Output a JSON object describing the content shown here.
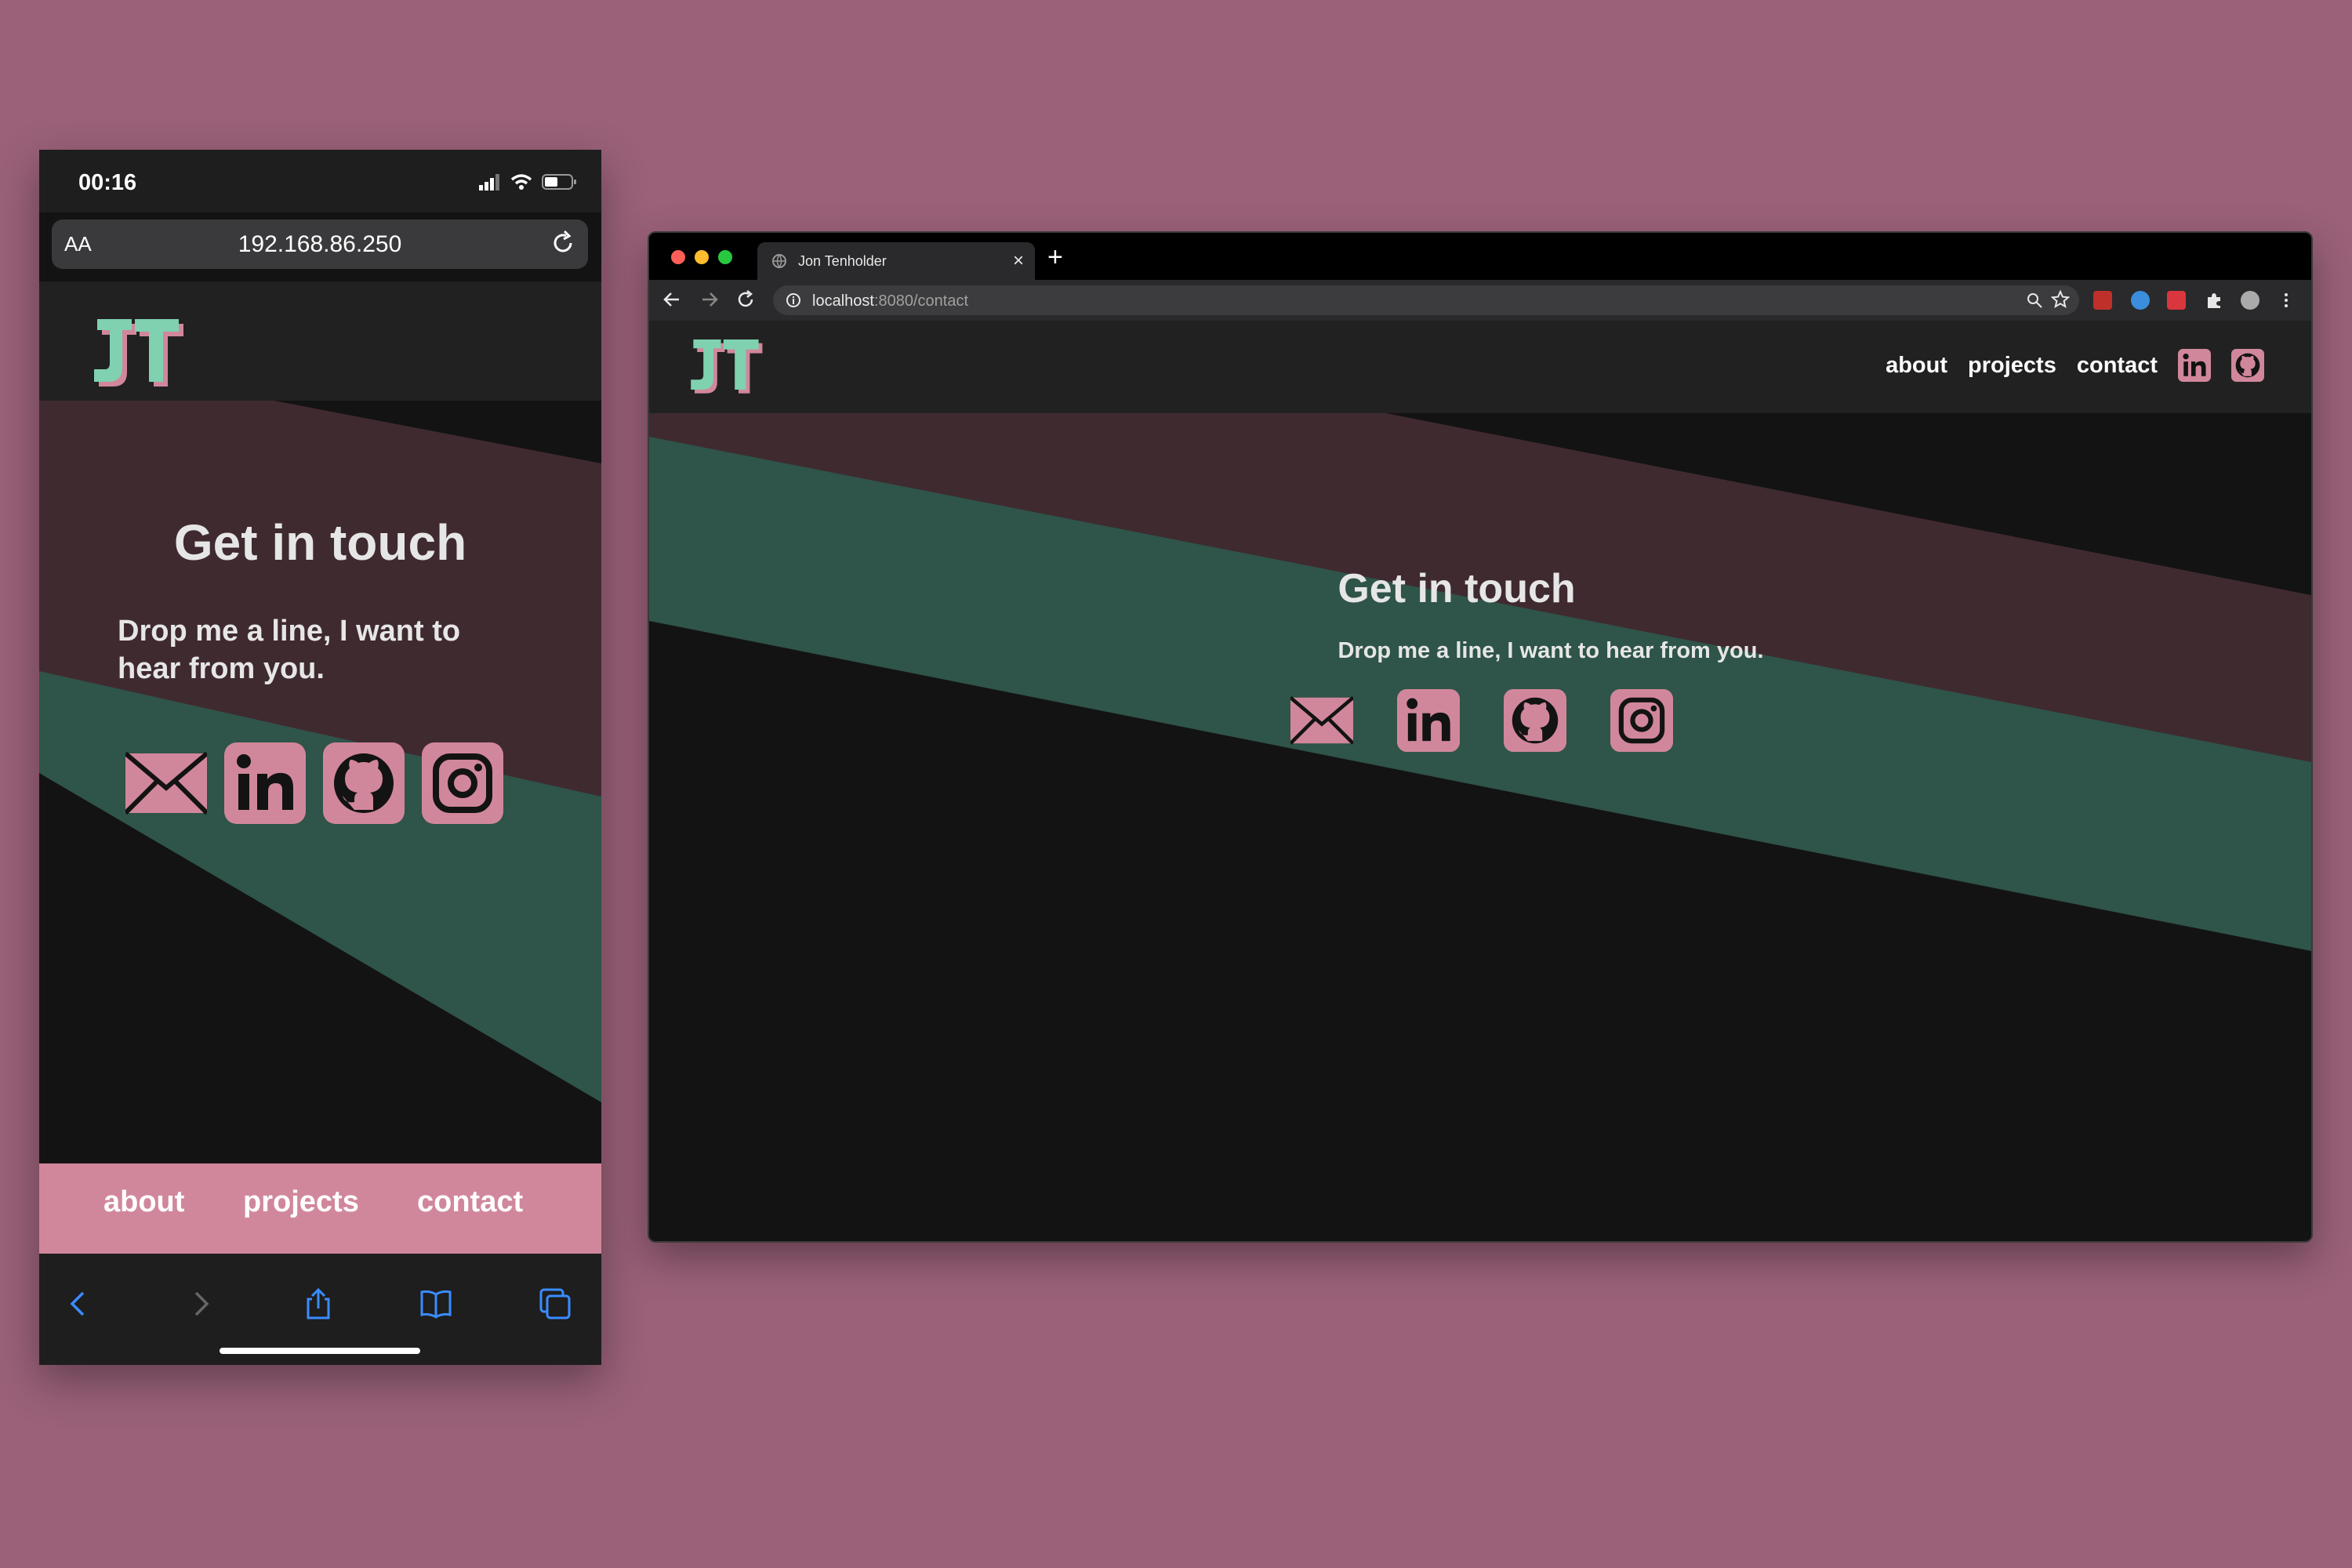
{
  "colors": {
    "background": "#9a6179",
    "accent_pink": "#d1879b",
    "accent_green": "#2f5449",
    "band_maroon": "#3f2a30",
    "page_dark": "#131313",
    "header_dark": "#212121",
    "logo_mint": "#7fd1b0"
  },
  "phone": {
    "time": "00:16",
    "aa_label": "AA",
    "url": "192.168.86.250",
    "title": "Get in touch",
    "subtitle": "Drop me a line, I want to hear from you.",
    "contact_icons": [
      "mail-icon",
      "linkedin-icon",
      "github-icon",
      "instagram-icon"
    ],
    "bottom_nav": [
      "about",
      "projects",
      "contact"
    ],
    "toolbar_icons": [
      "back-icon",
      "forward-icon",
      "share-icon",
      "bookmarks-icon",
      "tabs-icon"
    ]
  },
  "desktop": {
    "tab_title": "Jon Tenholder",
    "new_tab": "+",
    "tab_close": "×",
    "address_host": "localhost",
    "address_rest": ":8080/contact",
    "nav": [
      "about",
      "projects",
      "contact"
    ],
    "nav_icons": [
      "linkedin-icon",
      "github-icon"
    ],
    "title": "Get in touch",
    "subtitle": "Drop me a line, I want to hear from you.",
    "contact_icons": [
      "mail-icon",
      "linkedin-icon",
      "github-icon",
      "instagram-icon"
    ]
  }
}
